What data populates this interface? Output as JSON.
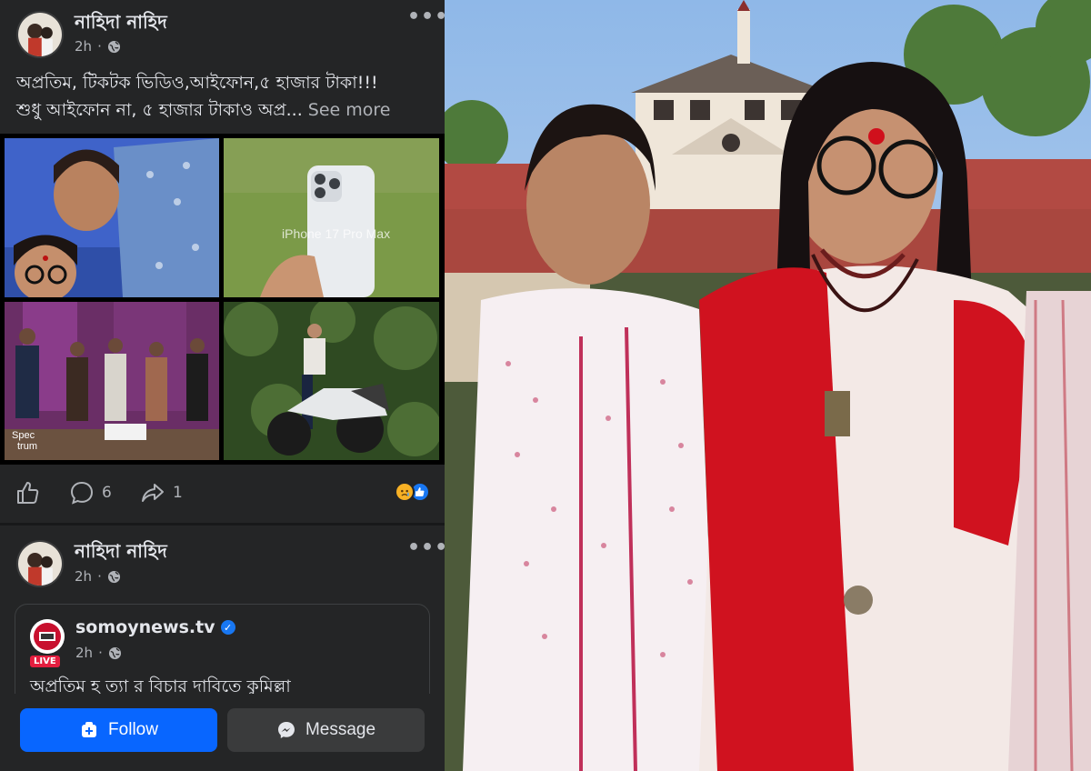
{
  "posts": [
    {
      "author": "নাহিদা নাহিদ",
      "time": "2h",
      "text_line1": "অপ্রতিম, টিকটক ভিডিও,আইফোন,৫ হাজার টাকা!!!",
      "text_line2": "শুধু আইফোন না, ৫ হাজার টাকাও অপ্র...",
      "see_more": "See more",
      "grid_images": [
        {
          "icon": "selfie-photo"
        },
        {
          "icon": "iphone-photo",
          "caption": "iPhone 17 Pro Max"
        },
        {
          "icon": "police-lineup-photo",
          "watermark_1": "Spec",
          "watermark_2": "trum"
        },
        {
          "icon": "motorcycle-photo"
        }
      ],
      "comments_count": "6",
      "shares_count": "1"
    },
    {
      "author": "নাহিদা নাহিদ",
      "time": "2h",
      "shared": {
        "page_name": "somoynews.tv",
        "time": "2h",
        "badge": "LIVE",
        "text": "অপ্রতিম হ ত্যা র বিচার দাবিতে কুমিল্লা"
      }
    }
  ],
  "buttons": {
    "follow": "Follow",
    "message": "Message"
  },
  "colors": {
    "panel": "#242526",
    "accent": "#0866ff",
    "secondary_button": "#3a3b3c"
  }
}
